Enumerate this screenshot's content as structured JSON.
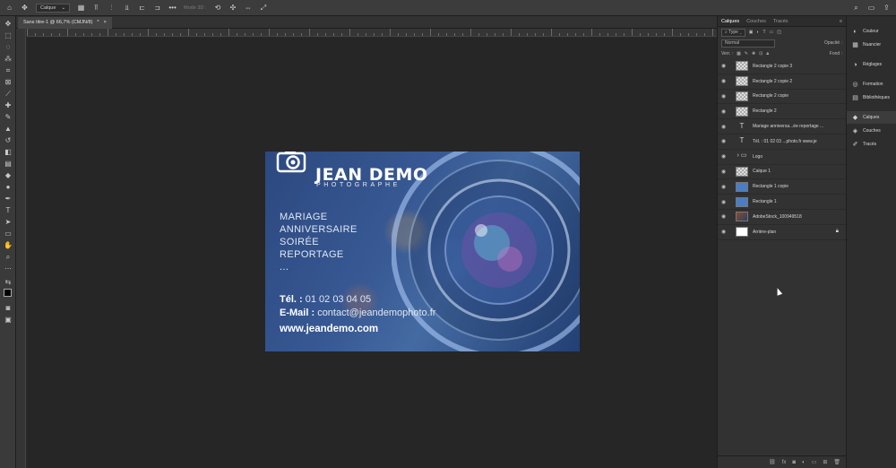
{
  "options_bar": {
    "layer_select": "Calque",
    "mode_text": "Mode 3D :",
    "icons": [
      "home-icon",
      "move-icon",
      "align-icons",
      "more-icon",
      "search-icon",
      "workspace-icon",
      "share-icon"
    ]
  },
  "document_tab": {
    "title": "Sans titre-1 @ 66,7% (CMJN/8)",
    "modified_marker": "*",
    "close": "×"
  },
  "business_card": {
    "name": "JEAN DEMO",
    "subtitle": "PHOTOGRAPHE",
    "services": [
      "MARIAGE",
      "ANNIVERSAIRE",
      "SOIRÉE",
      "REPORTAGE",
      "..."
    ],
    "phone_label": "Tél. :",
    "phone_value": "01 02 03 04 05",
    "email_label": "E-Mail :",
    "email_value": "contact@jeandemophoto.fr",
    "website": "www.jeandemo.com"
  },
  "layers_panel": {
    "tabs": [
      "Calques",
      "Couches",
      "Tracés"
    ],
    "filter_label": "Type",
    "blend_mode": "Normal",
    "opacity_label": "Opacité :",
    "lock_label": "Verr. :",
    "fill_label": "Fond :",
    "layers": [
      {
        "name": "Rectangle 2 copie 3",
        "thumb": "checker"
      },
      {
        "name": "Rectangle 2 copie 2",
        "thumb": "checker"
      },
      {
        "name": "Rectangle 2 copie",
        "thumb": "checker"
      },
      {
        "name": "Rectangle 2",
        "thumb": "checker"
      },
      {
        "name": "Mariage anniversa...ée reportage ...",
        "thumb": "text"
      },
      {
        "name": "Tél. : 01 02 03 ...photo.fr   www.je",
        "thumb": "text"
      },
      {
        "name": "Logo",
        "thumb": "folder"
      },
      {
        "name": "Calque 1",
        "thumb": "checker"
      },
      {
        "name": "Rectangle 1 copie",
        "thumb": "blue"
      },
      {
        "name": "Rectangle 1",
        "thumb": "blue"
      },
      {
        "name": "AdobeStock_100949518",
        "thumb": "photo"
      },
      {
        "name": "Arrière-plan",
        "thumb": "white"
      }
    ]
  },
  "dock": {
    "items": [
      "Couleur",
      "Nuancier",
      "Réglages",
      "Formation",
      "Bibliothèques",
      "Calques",
      "Couches",
      "Tracés"
    ]
  }
}
